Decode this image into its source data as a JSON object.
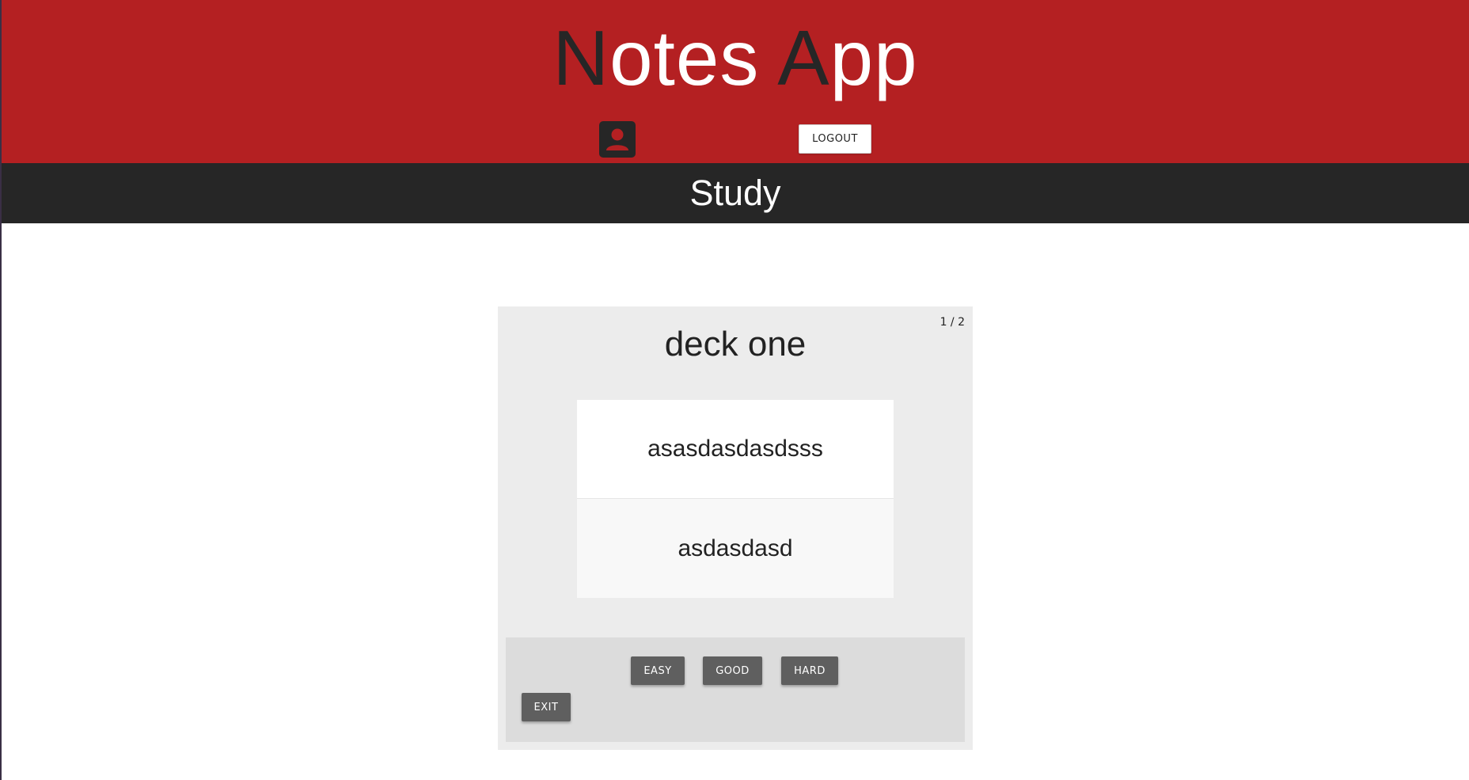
{
  "header": {
    "title_first_initial": "N",
    "title_first_rest": "otes ",
    "title_second_initial": "A",
    "title_second_rest": "pp",
    "logout_label": "LOGOUT",
    "user_icon": "account-box-icon"
  },
  "section": {
    "title": "Study"
  },
  "study": {
    "counter": "1 / 2",
    "deck_title": "deck one",
    "card_front": "asasdasdasdsss",
    "card_back": "asdasdasd",
    "buttons": {
      "easy": "EASY",
      "good": "GOOD",
      "hard": "HARD",
      "exit": "EXIT"
    }
  },
  "colors": {
    "header_bg": "#b42022",
    "section_bg": "#262626",
    "panel_bg": "#ececec",
    "button_bg": "#5f5f5f"
  }
}
